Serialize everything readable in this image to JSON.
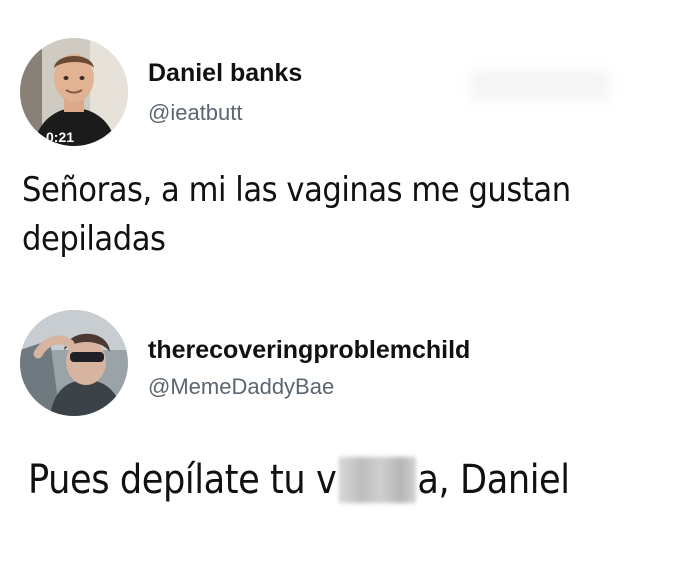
{
  "tweets": [
    {
      "display_name": "Daniel banks",
      "handle": "@ieatbutt",
      "text": "Señoras, a mi las vaginas me gustan depiladas",
      "avatar_icon": "profile-photo-man-black-shirt"
    },
    {
      "display_name": "therecoveringproblemchild",
      "handle": "@MemeDaddyBae",
      "text_before": "Pues depílate tu v",
      "text_censored": "",
      "text_after": "a, Daniel",
      "avatar_icon": "profile-photo-man-sunglasses-car"
    }
  ],
  "colors": {
    "background": "#ffffff",
    "text": "#111111",
    "handle": "#5b6670"
  }
}
